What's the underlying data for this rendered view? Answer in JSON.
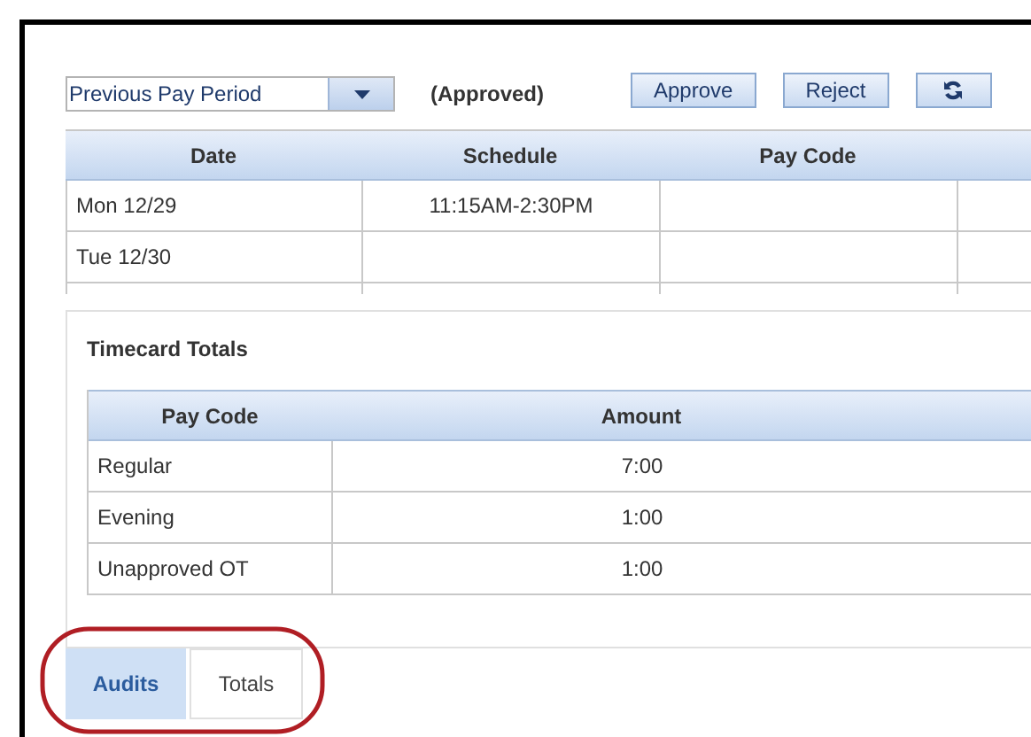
{
  "period_select": {
    "value": "Previous Pay Period"
  },
  "status": "(Approved)",
  "buttons": [
    {
      "kind": "text",
      "label": "Approve"
    },
    {
      "kind": "text",
      "label": "Reject"
    },
    {
      "kind": "refresh"
    }
  ],
  "timecard": {
    "columns": [
      "Date",
      "Schedule",
      "Pay Code"
    ],
    "rows": [
      {
        "cells": [
          "Mon 12/29",
          "11:15AM-2:30PM"
        ]
      },
      {
        "cells": [
          "Tue 12/30"
        ]
      }
    ]
  },
  "totals": {
    "title": "Timecard Totals",
    "columns": [
      "Pay Code",
      "Amount"
    ],
    "rows": [
      {
        "cells": [
          "Regular",
          "7:00"
        ]
      },
      {
        "cells": [
          "Evening",
          "1:00"
        ]
      },
      {
        "cells": [
          "Unapproved OT",
          "1:00"
        ]
      }
    ]
  },
  "tabs": [
    {
      "label": "Audits",
      "selected": true
    },
    {
      "label": "Totals",
      "selected": false
    }
  ]
}
